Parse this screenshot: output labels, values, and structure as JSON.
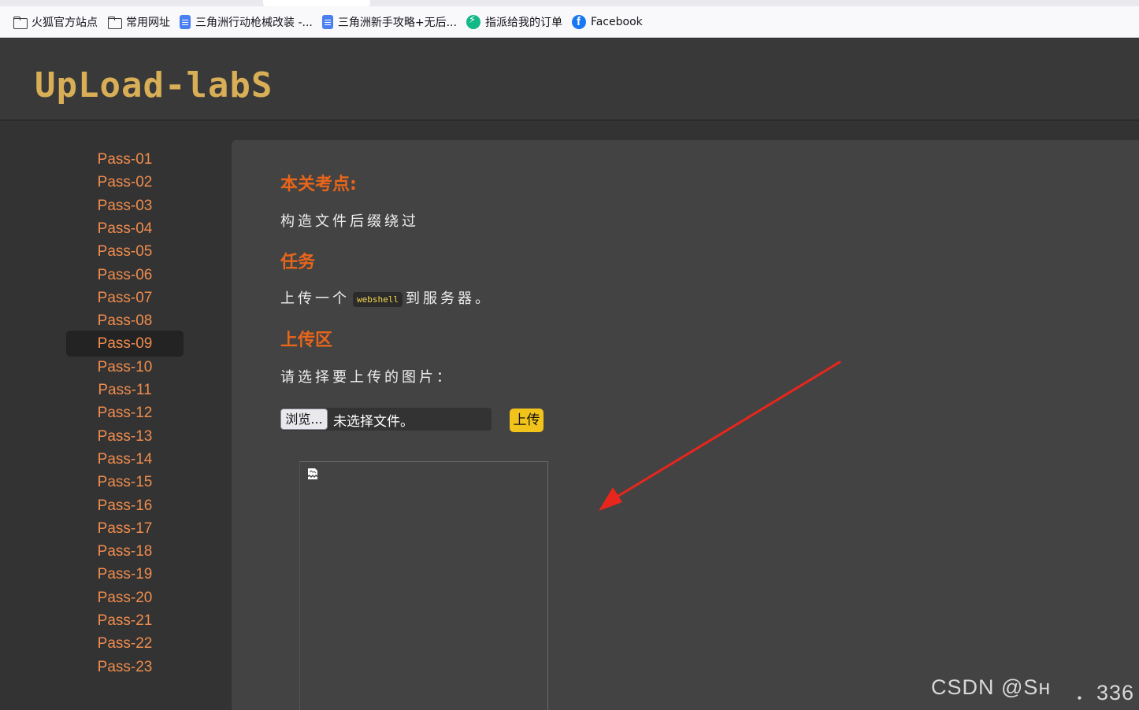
{
  "bookmarks": [
    {
      "label": "火狐官方站点",
      "icon": "folder-icon"
    },
    {
      "label": "常用网址",
      "icon": "folder-icon"
    },
    {
      "label": "三角洲行动枪械改装 -...",
      "icon": "document-icon"
    },
    {
      "label": "三角洲新手攻略+无后...",
      "icon": "document-icon"
    },
    {
      "label": "指派给我的订单",
      "icon": "bolt-icon"
    },
    {
      "label": "Facebook",
      "icon": "facebook-icon"
    }
  ],
  "header": {
    "logo_text": "UpLoad-labS"
  },
  "sidebar": {
    "items": [
      "Pass-01",
      "Pass-02",
      "Pass-03",
      "Pass-04",
      "Pass-05",
      "Pass-06",
      "Pass-07",
      "Pass-08",
      "Pass-09",
      "Pass-10",
      "Pass-11",
      "Pass-12",
      "Pass-13",
      "Pass-14",
      "Pass-15",
      "Pass-16",
      "Pass-17",
      "Pass-18",
      "Pass-19",
      "Pass-20",
      "Pass-21",
      "Pass-22",
      "Pass-23"
    ],
    "active": "Pass-09"
  },
  "main": {
    "section1_title": "本关考点:",
    "section1_text": "构造文件后缀绕过",
    "section2_title": "任务",
    "task_prefix": "上传一个",
    "task_code": "webshell",
    "task_suffix": "到服务器。",
    "section3_title": "上传区",
    "upload_prompt": "请选择要上传的图片：",
    "browse_label": "浏览...",
    "file_status": "未选择文件。",
    "upload_label": "上传"
  },
  "watermark": {
    "text": "CSDN @Sн",
    "suffix": "．336"
  },
  "colors": {
    "accent": "#e8651a",
    "nav": "#f08c4e",
    "logo": "#d8ae56",
    "button": "#f2c31a",
    "arrow": "#e8261c"
  }
}
